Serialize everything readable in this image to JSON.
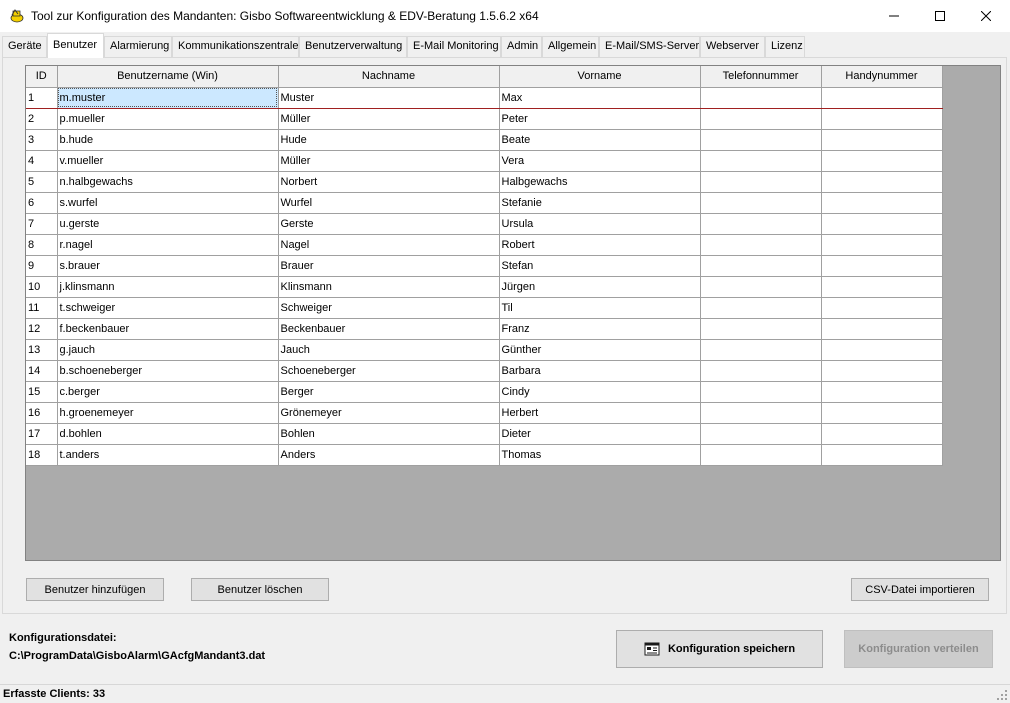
{
  "window": {
    "title": "Tool zur Konfiguration des Mandanten: Gisbo Softwareentwicklung & EDV-Beratung 1.5.6.2 x64",
    "controls": [
      "minimize-icon",
      "maximize-icon",
      "close-icon"
    ]
  },
  "tabs": [
    {
      "label": "Geräte",
      "active": false
    },
    {
      "label": "Benutzer",
      "active": true
    },
    {
      "label": "Alarmierung",
      "active": false
    },
    {
      "label": "Kommunikationszentrale",
      "active": false
    },
    {
      "label": "Benutzerverwaltung",
      "active": false
    },
    {
      "label": "E-Mail Monitoring",
      "active": false
    },
    {
      "label": "Admin",
      "active": false
    },
    {
      "label": "Allgemein",
      "active": false
    },
    {
      "label": "E-Mail/SMS-Server",
      "active": false
    },
    {
      "label": "Webserver",
      "active": false
    },
    {
      "label": "Lizenz",
      "active": false
    }
  ],
  "grid": {
    "columns": [
      "ID",
      "Benutzername (Win)",
      "Nachname",
      "Vorname",
      "Telefonnummer",
      "Handynummer"
    ],
    "rows": [
      [
        "1",
        "m.muster",
        "Muster",
        "Max",
        "",
        ""
      ],
      [
        "2",
        "p.mueller",
        "Müller",
        "Peter",
        "",
        ""
      ],
      [
        "3",
        "b.hude",
        "Hude",
        "Beate",
        "",
        ""
      ],
      [
        "4",
        "v.mueller",
        "Müller",
        "Vera",
        "",
        ""
      ],
      [
        "5",
        "n.halbgewachs",
        "Norbert",
        "Halbgewachs",
        "",
        ""
      ],
      [
        "6",
        "s.wurfel",
        "Wurfel",
        "Stefanie",
        "",
        ""
      ],
      [
        "7",
        "u.gerste",
        "Gerste",
        "Ursula",
        "",
        ""
      ],
      [
        "8",
        "r.nagel",
        "Nagel",
        "Robert",
        "",
        ""
      ],
      [
        "9",
        "s.brauer",
        "Brauer",
        "Stefan",
        "",
        ""
      ],
      [
        "10",
        "j.klinsmann",
        "Klinsmann",
        "Jürgen",
        "",
        ""
      ],
      [
        "11",
        "t.schweiger",
        "Schweiger",
        "Til",
        "",
        ""
      ],
      [
        "12",
        "f.beckenbauer",
        "Beckenbauer",
        "Franz",
        "",
        ""
      ],
      [
        "13",
        "g.jauch",
        "Jauch",
        "Günther",
        "",
        ""
      ],
      [
        "14",
        "b.schoeneberger",
        "Schoeneberger",
        "Barbara",
        "",
        ""
      ],
      [
        "15",
        "c.berger",
        "Berger",
        "Cindy",
        "",
        ""
      ],
      [
        "16",
        "h.groenemeyer",
        "Grönemeyer",
        "Herbert",
        "",
        ""
      ],
      [
        "17",
        "d.bohlen",
        "Bohlen",
        "Dieter",
        "",
        ""
      ],
      [
        "18",
        "t.anders",
        "Anders",
        "Thomas",
        "",
        ""
      ]
    ]
  },
  "buttons": {
    "add_user": "Benutzer hinzufügen",
    "delete_user": "Benutzer löschen",
    "import_csv": "CSV-Datei importieren",
    "save_config": "Konfiguration speichern",
    "distribute_config": "Konfiguration verteilen"
  },
  "config": {
    "label": "Konfigurationsdatei:",
    "path": "C:\\ProgramData\\GisboAlarm\\GAcfgMandant3.dat"
  },
  "status": {
    "text": "Erfasste Clients: 33"
  },
  "colors": {
    "selection": "#cce8ff",
    "current_row_line": "#a02020",
    "disabled_text": "#8c8c8c"
  }
}
